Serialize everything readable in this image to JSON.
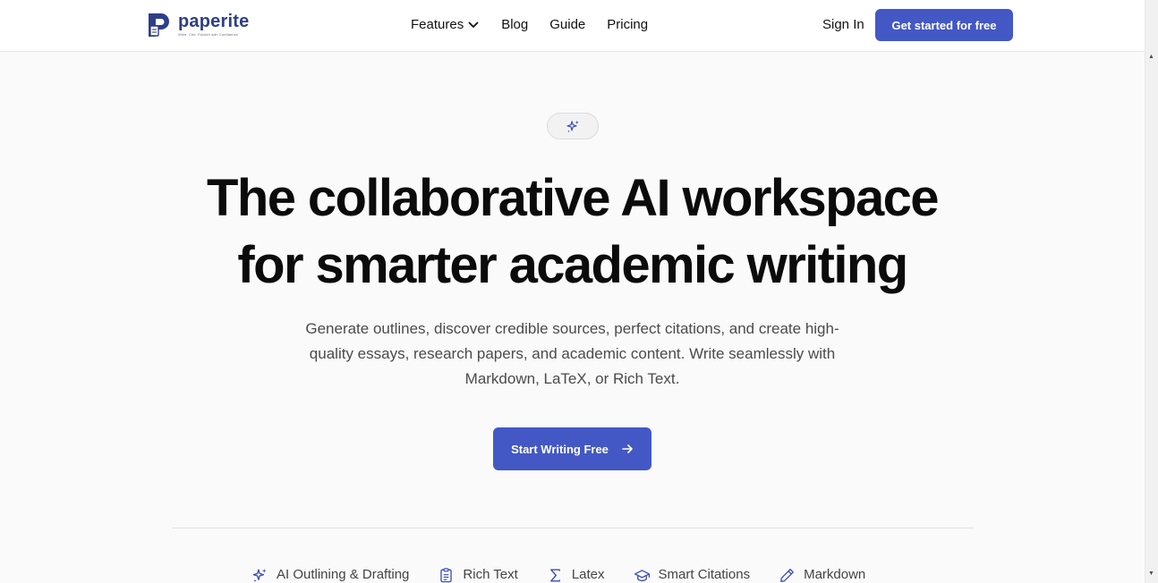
{
  "header": {
    "logo": {
      "name": "paperite",
      "tagline": "Write. Cite. Publish with Confidence"
    },
    "nav": [
      {
        "label": "Features",
        "has_dropdown": true
      },
      {
        "label": "Blog"
      },
      {
        "label": "Guide"
      },
      {
        "label": "Pricing"
      }
    ],
    "signin_label": "Sign In",
    "cta_label": "Get started for free"
  },
  "hero": {
    "badge_icon": "sparkles-icon",
    "headline_line1": "The collaborative AI workspace",
    "headline_line2": "for smarter academic writing",
    "subtext": "Generate outlines, discover credible sources, perfect citations, and create high-quality essays, research papers, and academic content. Write seamlessly with Markdown, LaTeX, or Rich Text.",
    "cta_label": "Start Writing Free",
    "cta_icon": "arrow-right-icon"
  },
  "features": [
    {
      "label": "AI Outlining & Drafting",
      "icon": "sparkles-icon"
    },
    {
      "label": "Rich Text",
      "icon": "clipboard-icon"
    },
    {
      "label": "Latex",
      "icon": "sigma-icon"
    },
    {
      "label": "Smart Citations",
      "icon": "graduation-cap-icon"
    },
    {
      "label": "Markdown",
      "icon": "pencil-icon"
    }
  ],
  "colors": {
    "accent": "#4358c4",
    "logo": "#2e3f87",
    "background": "#fafafa",
    "icon": "#3b4fb8"
  }
}
